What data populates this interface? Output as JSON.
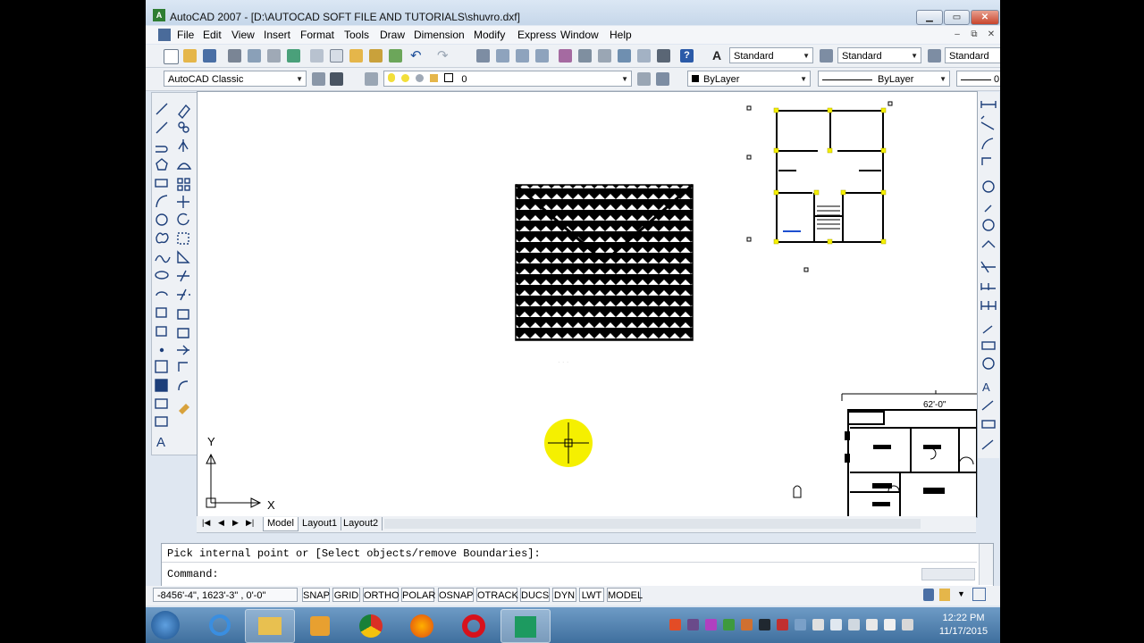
{
  "window": {
    "title": "AutoCAD 2007 - [D:\\AUTOCAD SOFT FILE AND TUTORIALS\\shuvro.dxf]"
  },
  "menu": [
    "File",
    "Edit",
    "View",
    "Insert",
    "Format",
    "Tools",
    "Draw",
    "Dimension",
    "Modify",
    "Express",
    "Window",
    "Help"
  ],
  "styles_toolbar": {
    "text_style": "Standard",
    "dim_style": "Standard",
    "table_style": "Standard"
  },
  "workspace": {
    "name": "AutoCAD Classic"
  },
  "layer": {
    "current": "0"
  },
  "properties": {
    "color": "ByLayer",
    "linetype": "ByLayer",
    "lineweight_partial": "0"
  },
  "drawing": {
    "dimension_label": "62'-0\"",
    "axis_x": "X",
    "axis_y": "Y"
  },
  "layout_tabs": [
    "Model",
    "Layout1",
    "Layout2"
  ],
  "command": {
    "history": "Pick internal point or [Select objects/remove Boundaries]:",
    "prompt": "Command:"
  },
  "status": {
    "coordinates": "-8456'-4\",  1623'-3\" , 0'-0\"",
    "toggles": [
      "SNAP",
      "GRID",
      "ORTHO",
      "POLAR",
      "OSNAP",
      "OTRACK",
      "DUCS",
      "DYN",
      "LWT",
      "MODEL"
    ]
  },
  "clock": {
    "time": "12:22 PM",
    "date": "11/17/2015"
  },
  "colors": {
    "hatch": "#000000",
    "cursor_highlight": "#f5f000",
    "grip": "#f5f000",
    "title_bg": "#dbe7f4"
  }
}
